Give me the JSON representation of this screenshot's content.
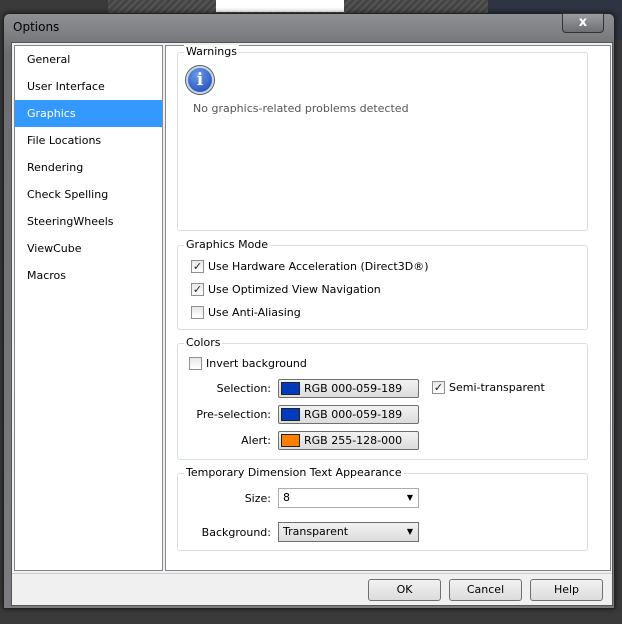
{
  "window": {
    "title": "Options",
    "close_label": "x"
  },
  "sidebar": {
    "items": [
      {
        "label": "General"
      },
      {
        "label": "User Interface"
      },
      {
        "label": "Graphics"
      },
      {
        "label": "File Locations"
      },
      {
        "label": "Rendering"
      },
      {
        "label": "Check Spelling"
      },
      {
        "label": "SteeringWheels"
      },
      {
        "label": "ViewCube"
      },
      {
        "label": "Macros"
      }
    ],
    "selected": "Graphics"
  },
  "warnings": {
    "title": "Warnings",
    "message": "No graphics-related problems detected"
  },
  "graphics_mode": {
    "title": "Graphics Mode",
    "options": [
      {
        "label": "Use Hardware Acceleration (Direct3D®)",
        "checked": true
      },
      {
        "label": "Use Optimized View Navigation",
        "checked": true
      },
      {
        "label": "Use Anti-Aliasing",
        "checked": false
      }
    ]
  },
  "colors": {
    "title": "Colors",
    "invert_background": {
      "label": "Invert background",
      "checked": false
    },
    "selection": {
      "label": "Selection:",
      "value": "RGB 000-059-189",
      "color": "#003bbd"
    },
    "semi_transparent": {
      "label": "Semi-transparent",
      "checked": true
    },
    "preselection": {
      "label": "Pre-selection:",
      "value": "RGB 000-059-189",
      "color": "#003bbd"
    },
    "alert": {
      "label": "Alert:",
      "value": "RGB 255-128-000",
      "color": "#ff8000"
    }
  },
  "temp_dim": {
    "title": "Temporary Dimension Text Appearance",
    "size_label": "Size:",
    "size_value": "8",
    "background_label": "Background:",
    "background_value": "Transparent"
  },
  "footer": {
    "ok": "OK",
    "cancel": "Cancel",
    "help": "Help"
  },
  "accent": "#3399ff"
}
